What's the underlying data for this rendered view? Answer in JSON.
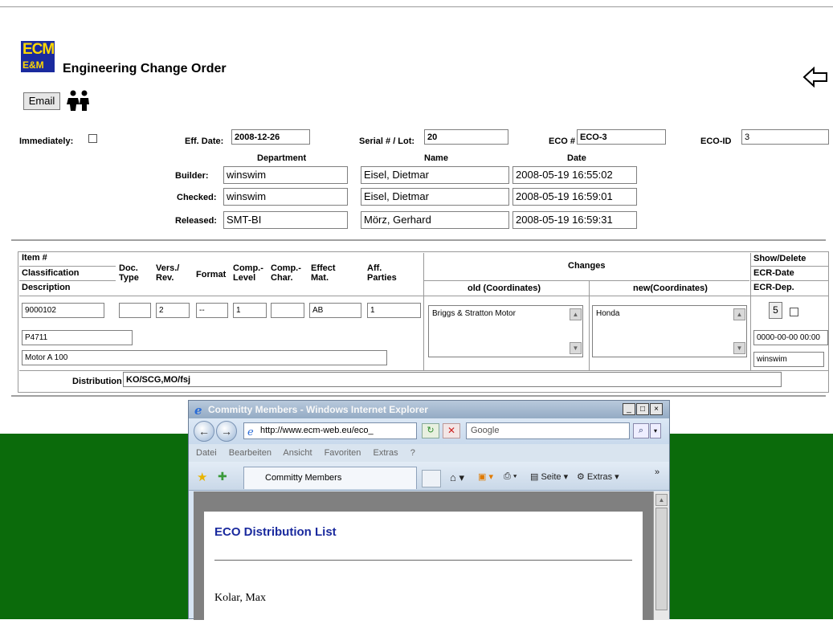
{
  "header": {
    "logo_top": "ECM",
    "logo_bottom": "E&M",
    "title": "Engineering Change Order",
    "email_label": "Email"
  },
  "form": {
    "immediately_label": "Immediately:",
    "eff_date_label": "Eff. Date:",
    "eff_date_value": "2008-12-26",
    "serial_label": "Serial # / Lot:",
    "serial_value": "20",
    "eco_label": "ECO #",
    "eco_value": "ECO-3",
    "ecoid_label": "ECO-ID",
    "ecoid_value": "3"
  },
  "approvals": {
    "col_department": "Department",
    "col_name": "Name",
    "col_date": "Date",
    "rows": [
      {
        "label": "Builder:",
        "department": "winswim",
        "name": "Eisel, Dietmar",
        "date": "2008-05-19 16:55:02"
      },
      {
        "label": "Checked:",
        "department": "winswim",
        "name": "Eisel, Dietmar",
        "date": "2008-05-19 16:59:01"
      },
      {
        "label": "Released:",
        "department": "SMT-BI",
        "name": "Mörz, Gerhard",
        "date": "2008-05-19 16:59:31"
      }
    ]
  },
  "items": {
    "headers": {
      "item": "Item #",
      "classification": "Classification",
      "description": "Description",
      "doc_type": "Doc. Type",
      "vers": "Vers./ Rev.",
      "format": "Format",
      "comp_level": "Comp.- Level",
      "comp_char": "Comp.- Char.",
      "effect_mat": "Effect Mat.",
      "aff_parties": "Aff. Parties",
      "changes": "Changes",
      "old": "old (Coordinates)",
      "new": "new(Coordinates)",
      "show_delete": "Show/Delete",
      "ecr_date": "ECR-Date",
      "ecr_dep": "ECR-Dep."
    },
    "row": {
      "item": "9000102",
      "doc_type": "",
      "vers": "2",
      "format": "--",
      "comp_level": "1",
      "comp_char": "",
      "effect_mat": "AB",
      "aff_parties": "1",
      "old": "Briggs & Stratton Motor",
      "new": "Honda",
      "show_btn": "5",
      "classification": "P4711",
      "ecr_date": "0000-00-00 00:00",
      "description": "Motor A 100",
      "ecr_dep": "winswim"
    },
    "distribution_label": "Distribution",
    "distribution_value": "KO/SCG,MO/fsj"
  },
  "browser": {
    "title": "Committy Members - Windows Internet Explorer",
    "address": "http://www.ecm-web.eu/eco_",
    "search_placeholder": "Google",
    "menu": [
      "Datei",
      "Bearbeiten",
      "Ansicht",
      "Favoriten",
      "Extras",
      "?"
    ],
    "tab_label": "Committy Members",
    "toolbar_seite": "Seite",
    "toolbar_extras": "Extras",
    "page_heading": "ECO Distribution List",
    "member": "Kolar, Max"
  },
  "colors": {
    "green_bg": "#0b6b0b",
    "heading_blue": "#1a2a9e",
    "logo_yellow": "#ffd800"
  }
}
